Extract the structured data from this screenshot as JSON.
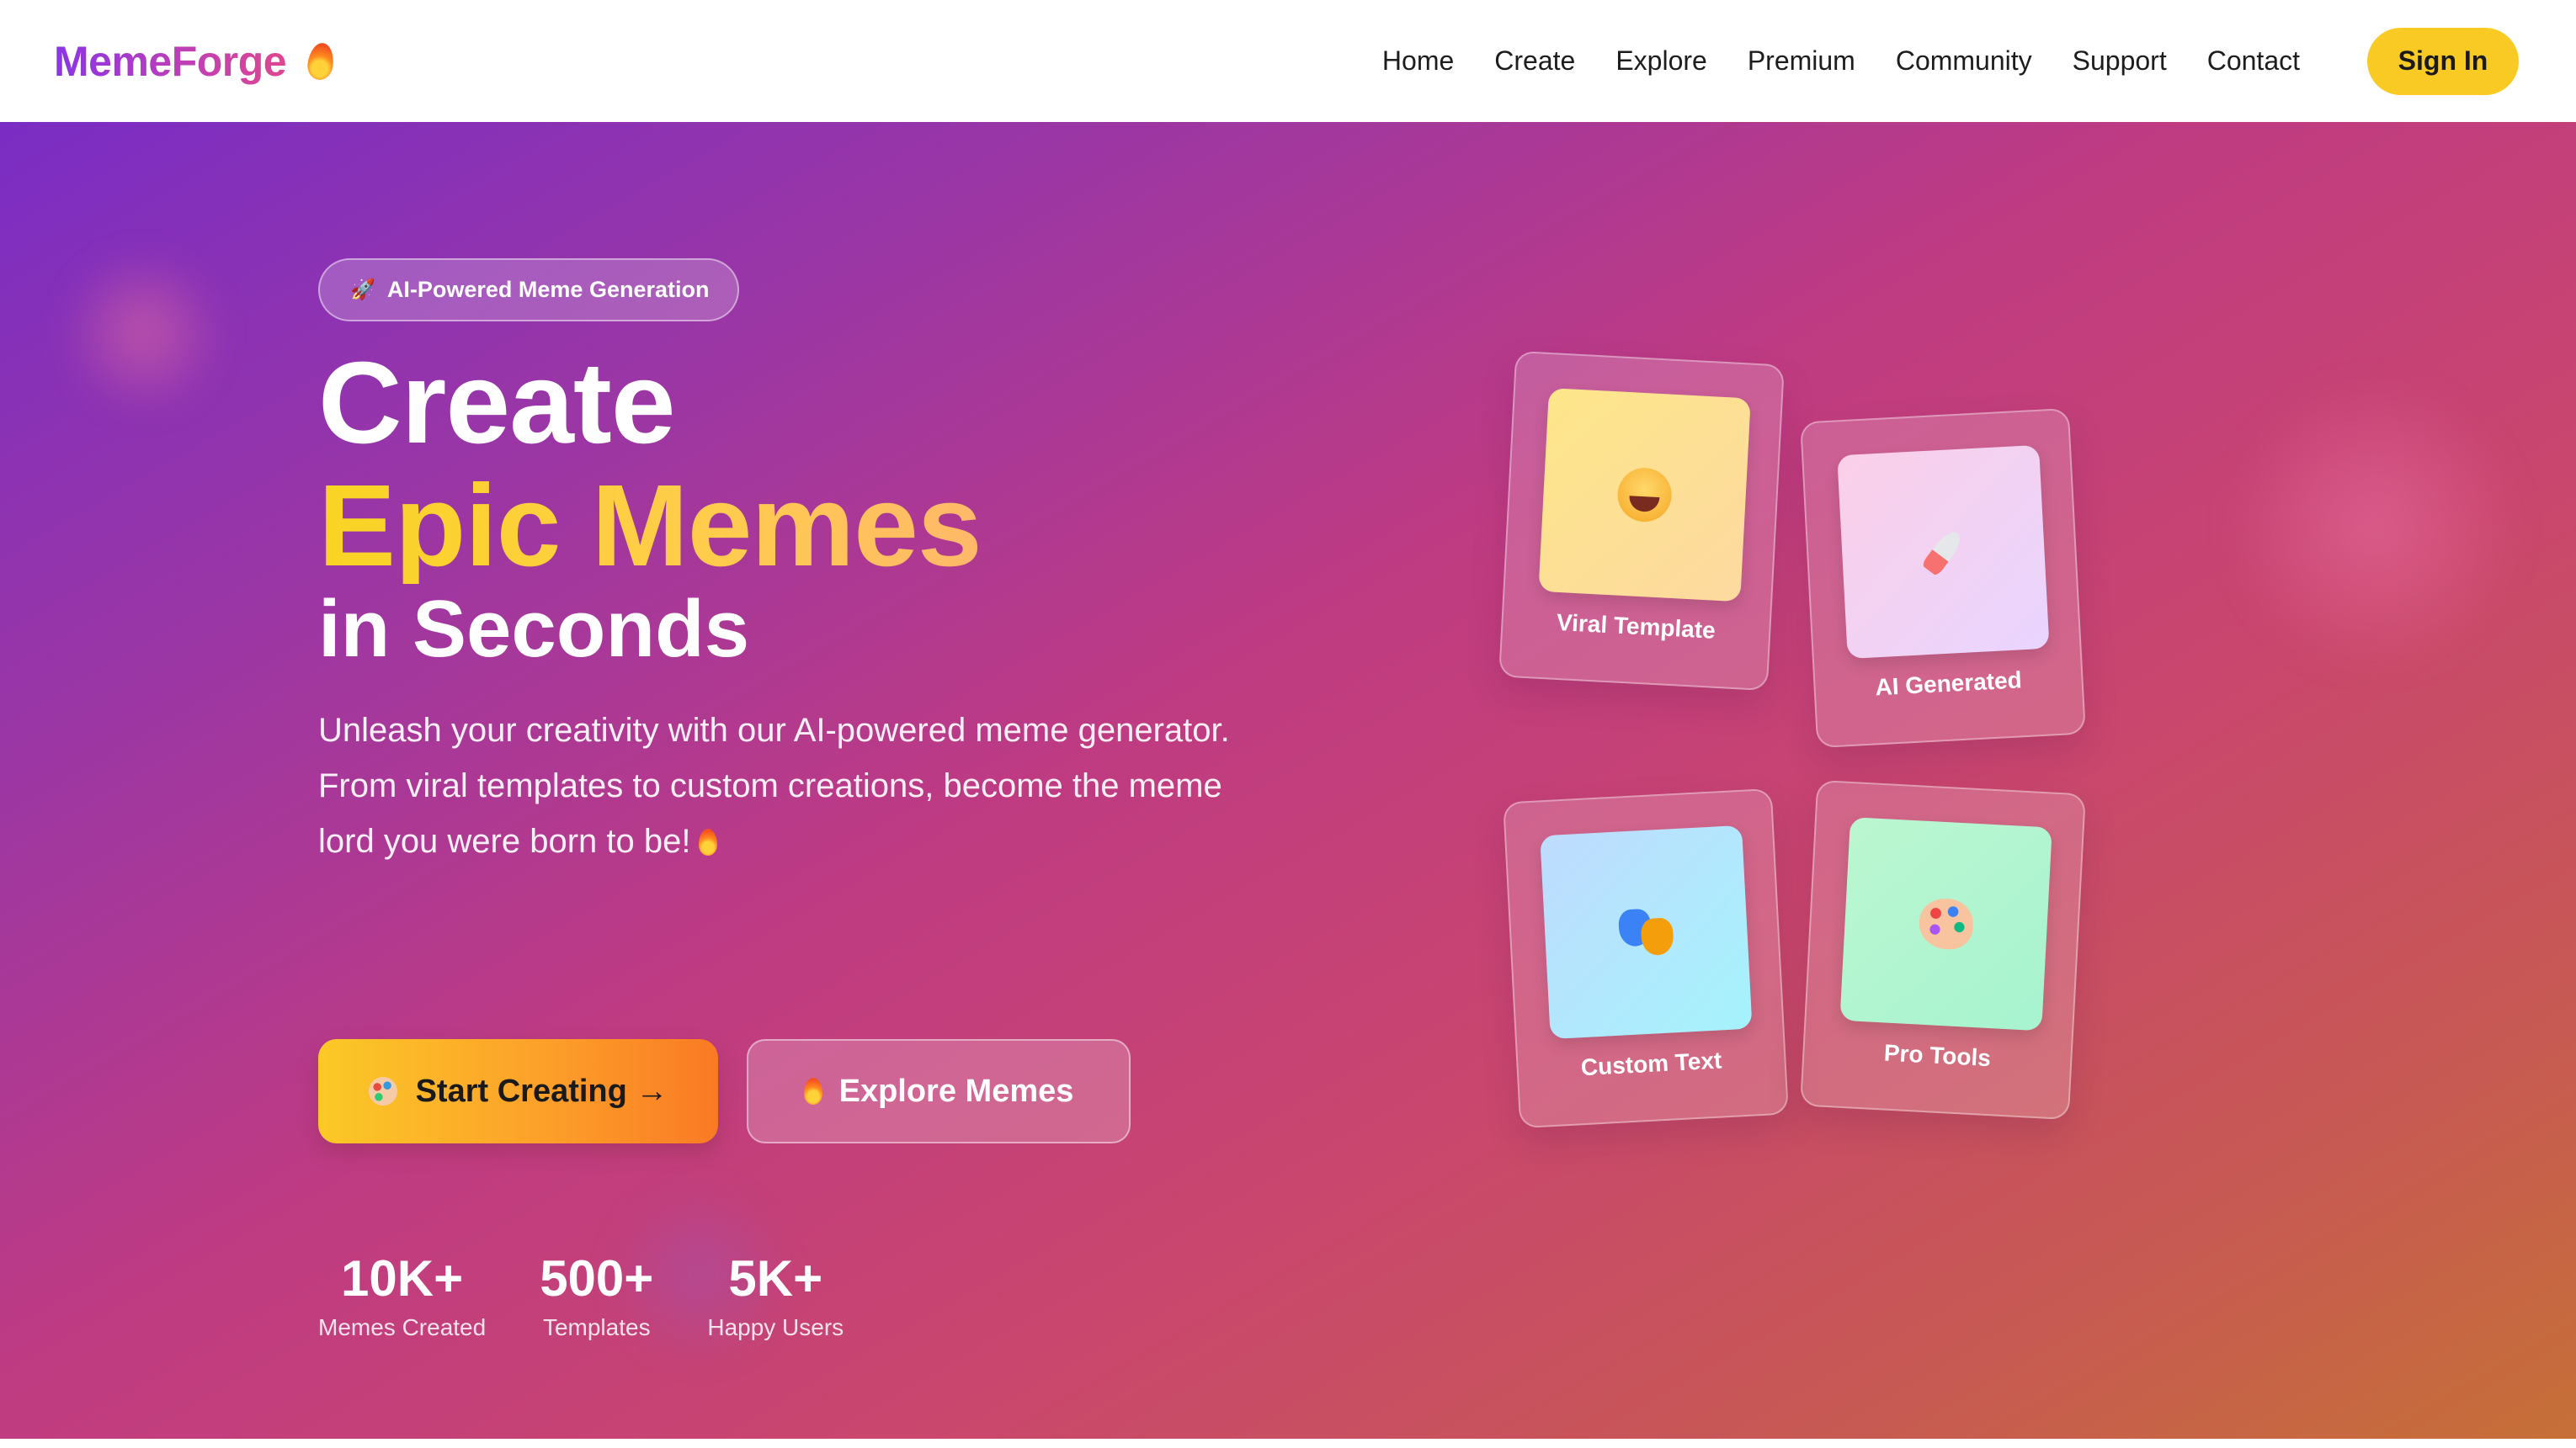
{
  "nav": {
    "brand": "MemeForge",
    "links": [
      "Home",
      "Create",
      "Explore",
      "Premium",
      "Community",
      "Support",
      "Contact"
    ],
    "signin_label": "Sign In"
  },
  "hero": {
    "badge": "AI-Powered Meme Generation",
    "title_line1": "Create",
    "title_line2": "Epic Memes",
    "title_line3": "in Seconds",
    "subtitle": "Unleash your creativity with our AI-powered meme generator. From viral templates to custom creations, become the meme lord you were born to be!",
    "primary_button": "Start Creating →",
    "secondary_button": "Explore Memes",
    "stats": [
      {
        "value": "10K+",
        "label": "Memes Created"
      },
      {
        "value": "500+",
        "label": "Templates"
      },
      {
        "value": "5K+",
        "label": "Happy Users"
      }
    ]
  },
  "cards": [
    {
      "label": "Viral Template",
      "icon": "laughing-face-icon"
    },
    {
      "label": "AI Generated",
      "icon": "rocket-icon"
    },
    {
      "label": "Custom Text",
      "icon": "theater-masks-icon"
    },
    {
      "label": "Pro Tools",
      "icon": "palette-icon"
    }
  ],
  "colors": {
    "accent_yellow": "#f9ca24",
    "brand_purple": "#8a35e6",
    "hero_gradient_start": "#7a2dc4",
    "hero_gradient_end": "#c67037"
  }
}
